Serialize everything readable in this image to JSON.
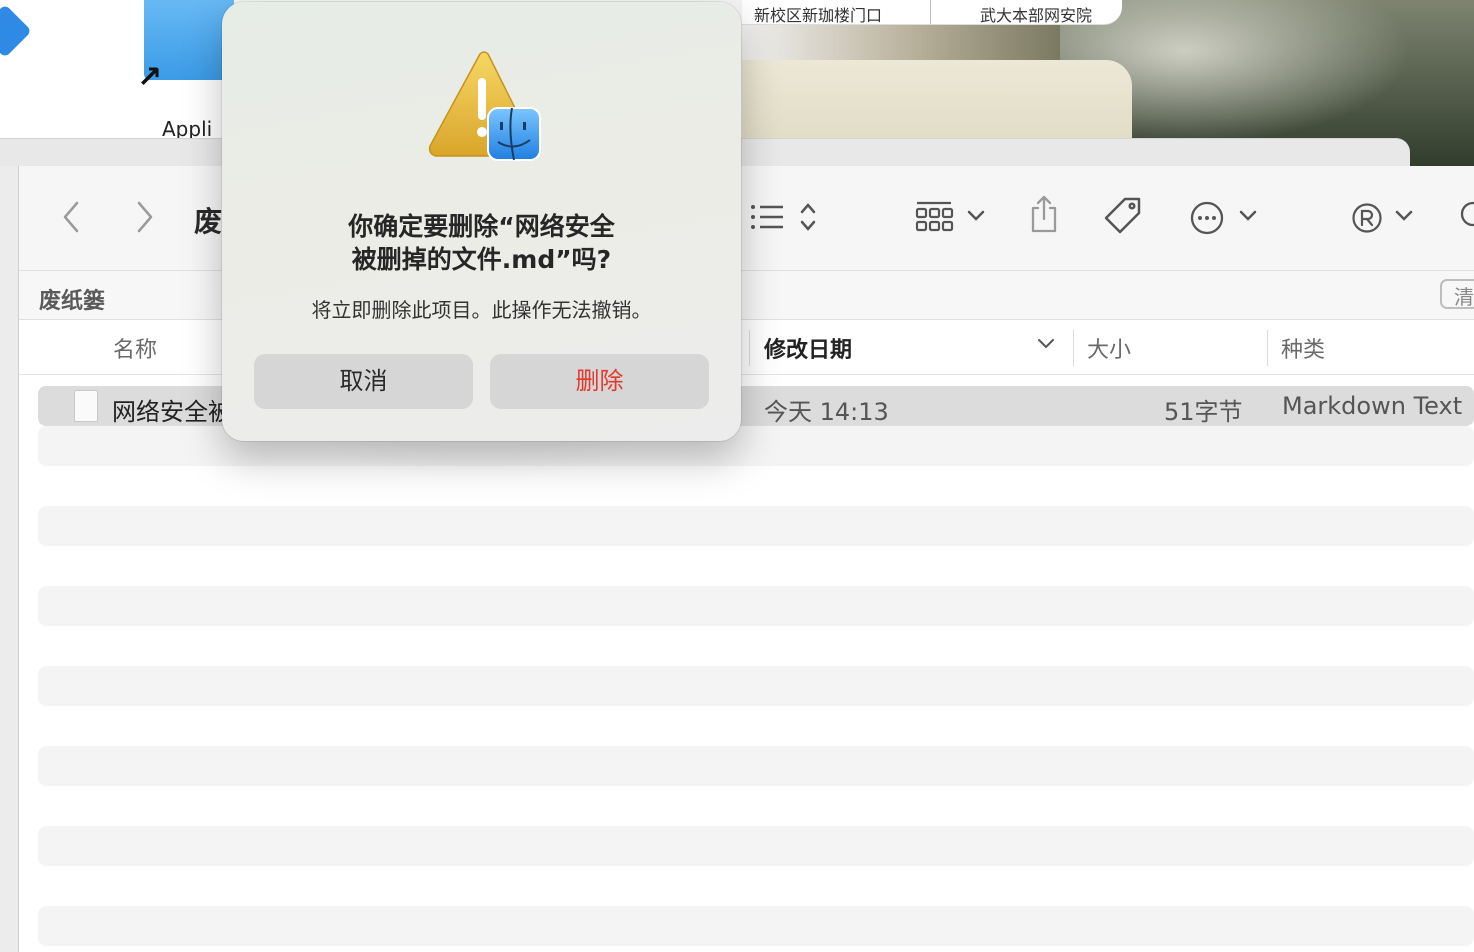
{
  "desktop": {
    "app_label": "Appli",
    "map_labels": [
      "新校区新珈楼门口",
      "武大本部网安院"
    ]
  },
  "finder": {
    "title": "废",
    "path_label": "废纸篓",
    "empty_button": "清",
    "columns": {
      "name": "名称",
      "modified": "修改日期",
      "size": "大小",
      "kind": "种类"
    },
    "rows": [
      {
        "name": "网络安全被",
        "modified": "今天 14:13",
        "size": "51字节",
        "kind": "Markdown Text"
      }
    ],
    "icons": [
      "back-icon",
      "forward-icon",
      "list-view-icon",
      "sort-updown-icon",
      "group-grid-icon",
      "share-icon",
      "tag-icon",
      "more-icon",
      "registered-icon",
      "search-icon"
    ]
  },
  "dialog": {
    "title": "你确定要删除“网络安全被删掉的文件.md”吗?",
    "title_line1": "你确定要删除“网络安全",
    "title_line2": "被删掉的文件.md”吗?",
    "message": "将立即删除此项目。此操作无法撤销。",
    "cancel_label": "取消",
    "delete_label": "删除",
    "icon": "warning-finder-icon",
    "delete_color": "#e03a2e"
  }
}
